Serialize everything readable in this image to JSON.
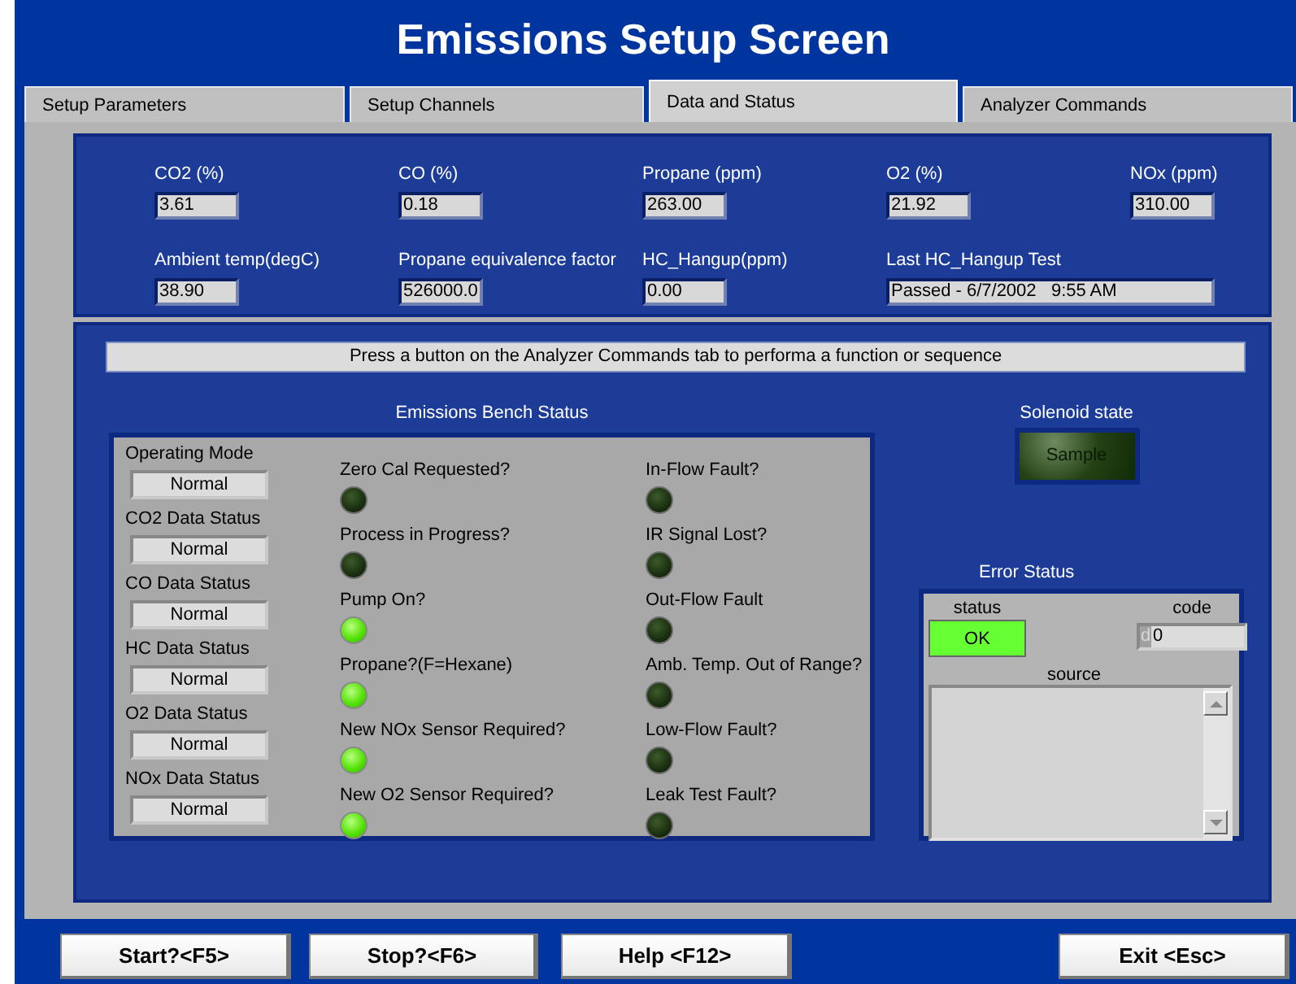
{
  "window": {
    "title": "Emissions Setup Screen"
  },
  "tabs": [
    {
      "label": "Setup Parameters",
      "selected": false
    },
    {
      "label": "Setup Channels",
      "selected": false
    },
    {
      "label": "Data and Status",
      "selected": true
    },
    {
      "label": "Analyzer Commands",
      "selected": false
    }
  ],
  "readings": [
    {
      "label": "CO2 (%)",
      "value": "3.61",
      "kind": "short"
    },
    {
      "label": "CO (%)",
      "value": "0.18",
      "kind": "short"
    },
    {
      "label": "Propane (ppm)",
      "value": "263.00",
      "kind": "short"
    },
    {
      "label": "O2 (%)",
      "value": "21.92",
      "kind": "short"
    },
    {
      "label": "NOx (ppm)",
      "value": "310.00",
      "kind": "short"
    },
    {
      "label": "Ambient temp(degC)",
      "value": "38.90",
      "kind": "short"
    },
    {
      "label": "Propane equivalence factor",
      "value": "526000.0",
      "kind": "short"
    },
    {
      "label": "HC_Hangup(ppm)",
      "value": "0.00",
      "kind": "short"
    },
    {
      "label": "Last HC_Hangup Test",
      "value": "Passed - 6/7/2002   9:55 AM",
      "kind": "wide"
    }
  ],
  "message": "Press a button on the Analyzer Commands tab to performa a function or sequence",
  "bench": {
    "title": "Emissions Bench Status",
    "fields": [
      {
        "label": "Operating Mode",
        "value": "Normal"
      },
      {
        "label": "CO2 Data Status",
        "value": "Normal"
      },
      {
        "label": "CO Data Status",
        "value": "Normal"
      },
      {
        "label": "HC Data Status",
        "value": "Normal"
      },
      {
        "label": "O2 Data Status",
        "value": "Normal"
      },
      {
        "label": "NOx Data Status",
        "value": "Normal"
      }
    ],
    "indicators": [
      {
        "label": "Zero Cal Requested?",
        "on": false
      },
      {
        "label": "Process in Progress?",
        "on": false
      },
      {
        "label": "Pump On?",
        "on": true
      },
      {
        "label": "Propane?(F=Hexane)",
        "on": true
      },
      {
        "label": "New NOx Sensor Required?",
        "on": true
      },
      {
        "label": "New O2 Sensor Required?",
        "on": true
      },
      {
        "label": "In-Flow Fault?",
        "on": false
      },
      {
        "label": "IR Signal Lost?",
        "on": false
      },
      {
        "label": "Out-Flow Fault",
        "on": false
      },
      {
        "label": "Amb. Temp. Out of Range?",
        "on": false
      },
      {
        "label": "Low-Flow Fault?",
        "on": false
      },
      {
        "label": "Leak Test Fault?",
        "on": false
      }
    ]
  },
  "solenoid": {
    "label": "Solenoid state",
    "value": "Sample",
    "on": false
  },
  "error_status": {
    "title": "Error Status",
    "status_label": "status",
    "status_value": "OK",
    "ok": true,
    "code_label": "code",
    "radix": "d",
    "code": "0",
    "source_label": "source"
  },
  "buttons": [
    {
      "label": "Start?<F5>"
    },
    {
      "label": "Stop?<F6>"
    },
    {
      "label": "Help <F12>"
    },
    {
      "label": "Exit <Esc>"
    }
  ]
}
